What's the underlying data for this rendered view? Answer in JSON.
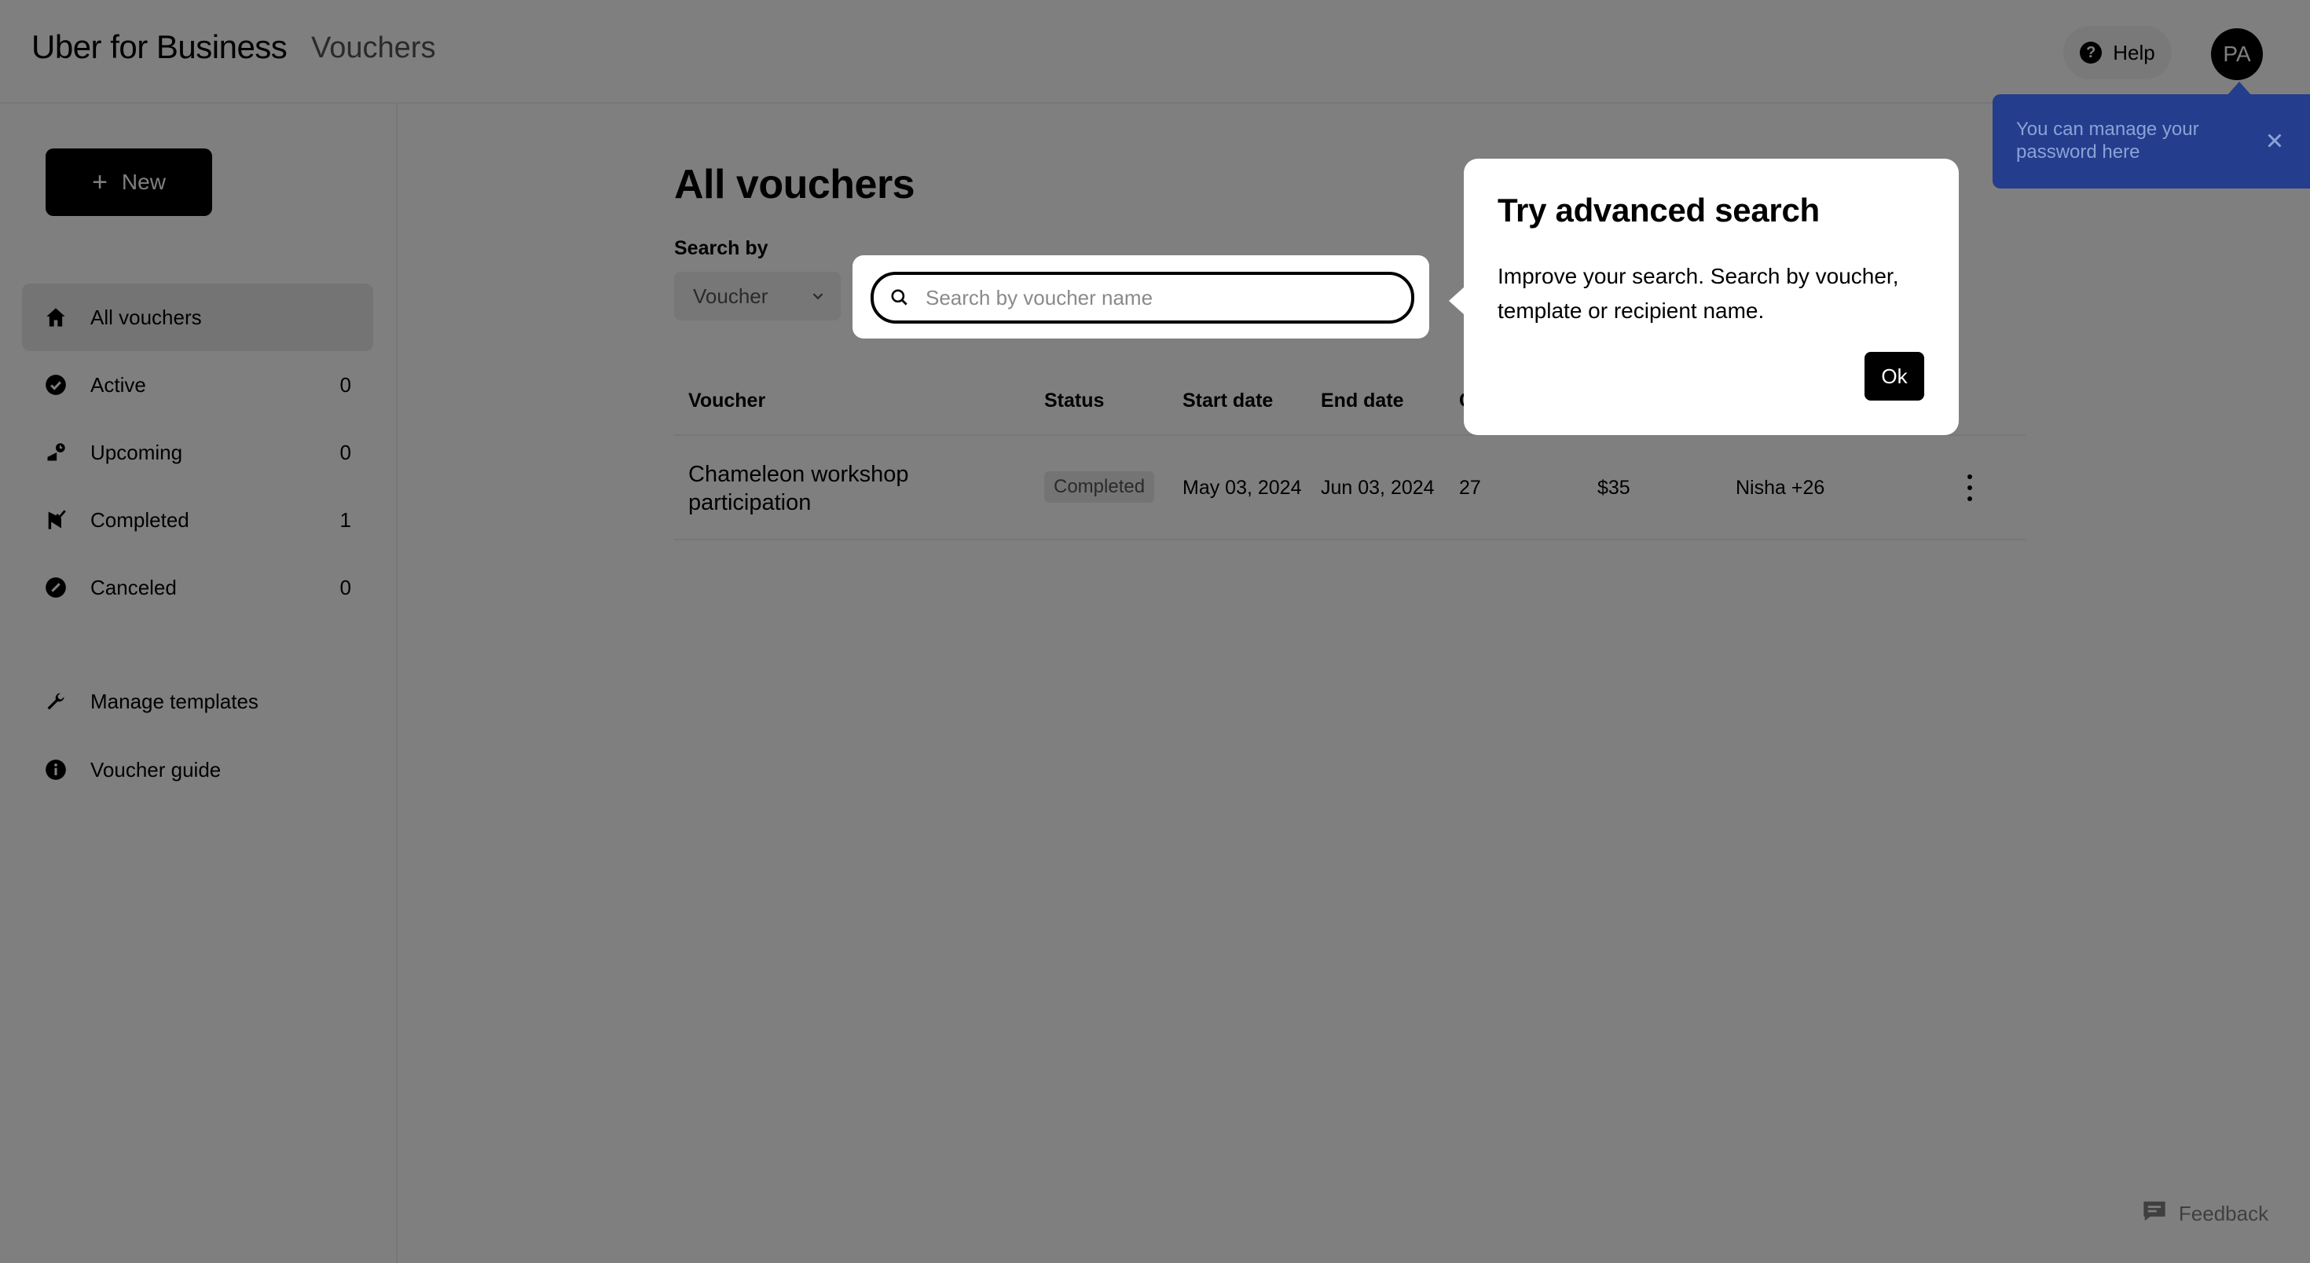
{
  "header": {
    "brand": "Uber for Business",
    "section": "Vouchers",
    "help_label": "Help",
    "avatar_initials": "PA"
  },
  "sidebar": {
    "new_label": "New",
    "items": [
      {
        "label": "All vouchers",
        "count": "",
        "icon": "home-icon",
        "active": true
      },
      {
        "label": "Active",
        "count": "0",
        "icon": "check-circle-icon"
      },
      {
        "label": "Upcoming",
        "count": "0",
        "icon": "upcoming-icon"
      },
      {
        "label": "Completed",
        "count": "1",
        "icon": "completed-flag-icon"
      },
      {
        "label": "Canceled",
        "count": "0",
        "icon": "canceled-icon"
      }
    ],
    "links": [
      {
        "label": "Manage templates",
        "icon": "wrench-icon"
      },
      {
        "label": "Voucher guide",
        "icon": "info-icon"
      }
    ]
  },
  "main": {
    "title": "All vouchers",
    "search_by_label": "Search by",
    "search_by_value": "Voucher",
    "search_placeholder": "Search by voucher name",
    "table": {
      "headers": [
        "Voucher",
        "Status",
        "Start date",
        "End date",
        "C"
      ],
      "rows": [
        {
          "voucher": "Chameleon workshop participation",
          "status": "Completed",
          "start_date": "May 03, 2024",
          "end_date": "Jun 03, 2024",
          "count": "27",
          "amount": "$35",
          "recipients": "Nisha +26"
        }
      ]
    }
  },
  "tooltip": {
    "title": "Try advanced search",
    "body": "Improve your search. Search by voucher, template or recipient name.",
    "ok_label": "Ok"
  },
  "password_tip": {
    "text": "You can manage your password here"
  },
  "feedback": {
    "label": "Feedback"
  },
  "colors": {
    "overlay": "#000000",
    "password_tip_bg": "#243d8c",
    "primary": "#000000"
  }
}
